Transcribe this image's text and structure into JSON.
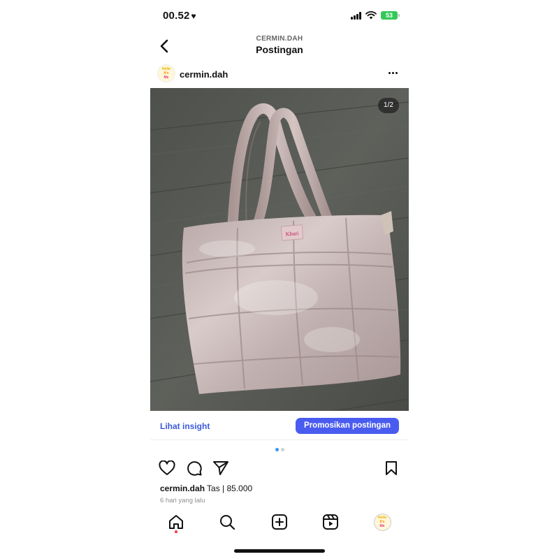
{
  "status_bar": {
    "time": "00.52",
    "heart": "♥",
    "battery": "53"
  },
  "header": {
    "subtitle": "CERMIN.DAH",
    "title": "Postingan"
  },
  "post": {
    "username": "cermin.dah",
    "avatar_text": [
      "Hello",
      "It's",
      "Me"
    ],
    "photo_counter": "1/2",
    "bag_label": "Khuri",
    "insight_link": "Lihat insight",
    "promote_button": "Promosikan postingan",
    "carousel": {
      "total": 2,
      "active": 1
    },
    "caption_user": "cermin.dah",
    "caption_text": "Tas | 85.000",
    "time_ago": "6 hari yang lalu"
  },
  "icons": {
    "actions": [
      "heart-icon",
      "comment-icon",
      "share-icon",
      "bookmark-icon"
    ],
    "tabs": [
      "home-icon",
      "search-icon",
      "create-icon",
      "reels-icon",
      "profile-avatar"
    ]
  },
  "colors": {
    "accent": "#4a5cf0",
    "link": "#3b5bdb",
    "battery": "#34c759",
    "notification": "#ff3040"
  }
}
